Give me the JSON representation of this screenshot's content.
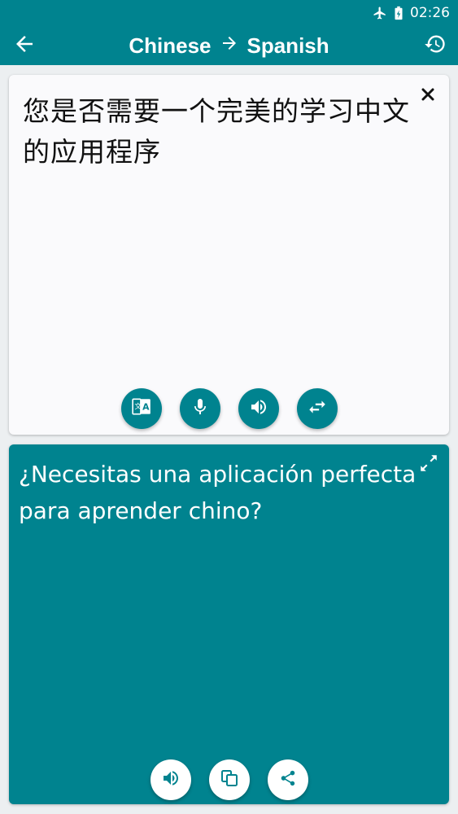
{
  "status_bar": {
    "time": "02:26",
    "icons": [
      "airplane-icon",
      "battery-charging-icon"
    ]
  },
  "app_bar": {
    "source_language": "Chinese",
    "arrow": "→",
    "target_language": "Spanish",
    "back_icon": "arrow-back-icon",
    "history_icon": "history-icon"
  },
  "source": {
    "text": "您是否需要一个完美的学习中文的应用程序",
    "clear_icon": "close-icon",
    "actions": [
      {
        "name": "camera-translate-button",
        "icon": "translate-image-icon"
      },
      {
        "name": "microphone-button",
        "icon": "microphone-icon"
      },
      {
        "name": "speak-source-button",
        "icon": "speaker-icon"
      },
      {
        "name": "swap-languages-button",
        "icon": "swap-icon"
      }
    ]
  },
  "target": {
    "text": "¿Necesitas una aplicación perfecta para aprender chino?",
    "expand_icon": "fullscreen-icon",
    "actions": [
      {
        "name": "speak-target-button",
        "icon": "speaker-icon"
      },
      {
        "name": "copy-button",
        "icon": "copy-icon"
      },
      {
        "name": "share-button",
        "icon": "share-icon"
      }
    ]
  },
  "colors": {
    "primary": "#00838F",
    "card_light": "#FAFAFC",
    "background": "#ECEFF1"
  }
}
